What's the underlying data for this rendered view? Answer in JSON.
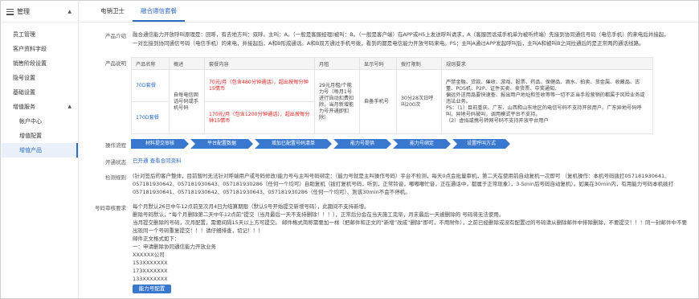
{
  "sidebar": {
    "header": "管理",
    "items": [
      {
        "label": "员工管理"
      },
      {
        "label": "客户资料字段"
      },
      {
        "label": "销售阶段设置"
      },
      {
        "label": "隐号设置"
      },
      {
        "label": "基础设置"
      }
    ],
    "group": {
      "label": "增值服务"
    },
    "sub_items": [
      {
        "label": "帐户中心"
      },
      {
        "label": "增值配置"
      },
      {
        "label": "增值产品"
      }
    ]
  },
  "tabs": [
    {
      "label": "电销卫士"
    },
    {
      "label": "融合通信套餐"
    }
  ],
  "product_intro": {
    "label": "产品介绍",
    "line1": "融合通信能力开放呼叫原理是：回呼，有去地方叫：双呼。主叫：A。（一般是客服经理)被叫：B。（一般是客户端）在APP或H5上发送呼叫请求，A（客服团话或手机单为被听终端）先接到协同通信号码（电信手机）的来电后并接起，",
    "line2": "一对比接到协同通信号码（电信手机）的来电，并接起后，A和B形成通话。A和B双方通过手机号拨，看到的都是电信能力开放号码来电。PS：主叫A通过APP发起呼叫后，主叫A和被叫B之间拉通后的是正常两的通话线路。"
  },
  "product_desc_label": "产品说明",
  "table": {
    "headers": [
      "产品名称",
      "概述",
      "套餐内容",
      "月租",
      "显示号码",
      "拨打限制",
      "规则要求"
    ],
    "rows": [
      {
        "name": "70D套餐",
        "content": "70元/月（包含480分钟通话），超出按每分钟15情币"
      },
      {
        "name": "170D套餐",
        "content": "170元/月（包含1200分钟通话），超出按每分钟15情币"
      }
    ],
    "overview": "自每电信固话号码或手机号码",
    "monthly": "29元月租/个能力号（每月1号进行自动扣费扣除，当月新增能力号开通即扣除）",
    "display": "自备手机号",
    "limit": "30分28次日呼叫200次",
    "rules": [
      "严禁金融、贷款、催收、游戏、股票、药品、保健品、酒水、拍卖、货金属、收藏品、古董、POS机、P2P、证件买卖、卖货票、中奖通知、",
      "偏远外送用品要快速查、报出用户地址和签收等等一切不正当手段营销的都属于风险业务或违法业务。",
      "PS：（1）目前重庆、广东、山西和山东地区的电信号码不支持开放用户。广东异地号码呼叫，异地号码被叫，调用模式平台不支持。",
      "（2）虚拟或携号转网号码不支持开放平台用户"
    ]
  },
  "flow": {
    "label": "操作流程",
    "steps": [
      "材料提交审核",
      "平台配置数据",
      "增加已配置号码清单",
      "能力号提供",
      "能力号绑定",
      "设置呼叫方式"
    ]
  },
  "status": {
    "label": "开通状态",
    "value": "已开通",
    "link": "查看合同资料"
  },
  "check_rules": {
    "label": "检测规则",
    "line1": "(针对签后的客户整体，目前暂时无法针对呼端用户或号码修改)能力号与主叫号码绑定：（能力号就是主叫操作号码）平台不检测，每天0点会批量审机，第二天在使用前自动复机一次即可 （复机操作：本机号码拨打057181930641、",
    "line2": "057181930642、057181930643、057181930286（任何一个均可）自助复机（拨打复机号码，听到，正常铃音，嘟嘟嘟忙音，正在通话中，都属于正常现象），3-5min后号码自动复机）。如果在30min内，有用能力号码本机拨打",
    "line3": "057181930641、057181930642、057181930643、057181930286（任何一个均可）、则该30min不会不停机。"
  },
  "review": {
    "label": "号码审核要求",
    "lines": [
      "每个月默认26日中午12点前至次月4日为结算期限（默认5号开始提交新增号码），此期间不支持新增。",
      "删除号码默认，“每个月删除第二天中午12点前”提交（当月最后一天不支持删除！！！），正常后分会在当天施工完毕，月末最后一天被删除的 号码将无法使用。",
      "当月提交删除的号码，次月配置，需要间隔15天以上方可提交。 邮件格式简称需要加一样（把邮件和正文的“新增”改成“删除”即可，不用附件），之前已经删除或没有配置过的号码请从删除邮件中排除删除，不要提交！！！同一封邮件中不要",
      "出现同一个号码重复提交！！！请仔细排查，切记！！！",
      "邮件正文格式如下：",
      "一：申请删除协同通信能力开放业务",
      "XXXXXX公司",
      "153XXXXXXX",
      "173XXXXXXX",
      "133XXXXXXX"
    ],
    "button": "能力号配置"
  }
}
